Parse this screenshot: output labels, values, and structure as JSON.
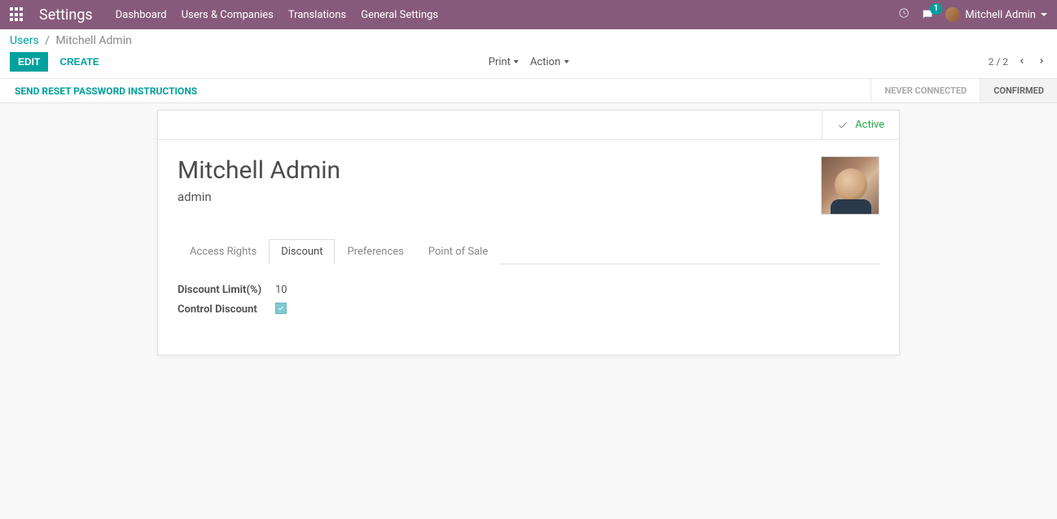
{
  "topbar": {
    "brand": "Settings",
    "nav": [
      "Dashboard",
      "Users & Companies",
      "Translations",
      "General Settings"
    ],
    "chat_badge": "1",
    "user_name": "Mitchell Admin"
  },
  "breadcrumb": {
    "root": "Users",
    "current": "Mitchell Admin"
  },
  "controls": {
    "edit": "EDIT",
    "create": "CREATE",
    "print": "Print",
    "action": "Action",
    "pager": "2 / 2"
  },
  "actionbar": {
    "reset_pw": "SEND RESET PASSWORD INSTRUCTIONS",
    "status_never": "NEVER CONNECTED",
    "status_confirmed": "CONFIRMED"
  },
  "form": {
    "status_label": "Active",
    "name": "Mitchell Admin",
    "login": "admin",
    "tabs": [
      "Access Rights",
      "Discount",
      "Preferences",
      "Point of Sale"
    ],
    "active_tab": "Discount",
    "discount": {
      "limit_label": "Discount Limit(%)",
      "limit_value": "10",
      "control_label": "Control Discount",
      "control_checked": true
    }
  }
}
